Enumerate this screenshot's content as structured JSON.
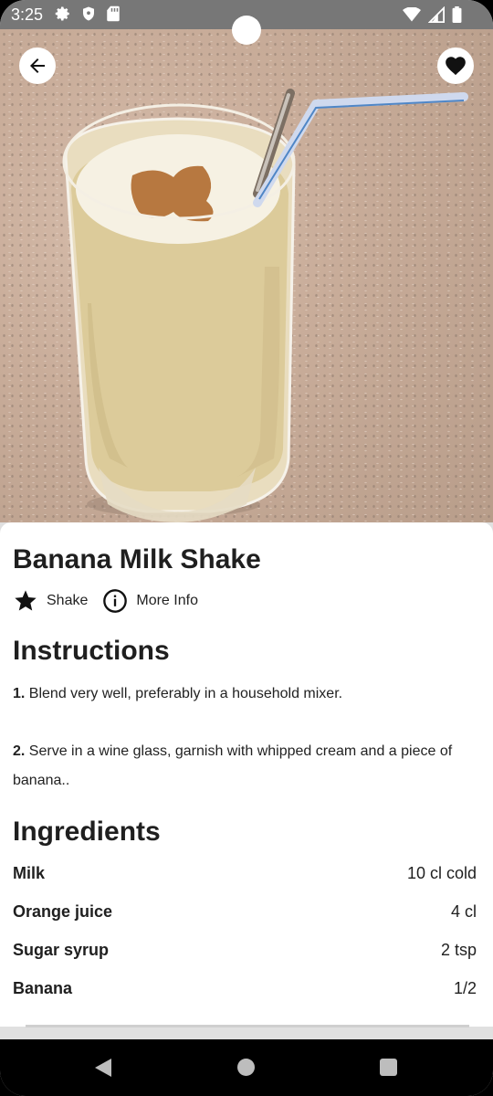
{
  "status_bar": {
    "time": "3:25",
    "left_icons": [
      "gear-icon",
      "shield-icon",
      "sd-card-icon"
    ],
    "right_icons": [
      "wifi-icon",
      "signal-icon",
      "battery-icon"
    ]
  },
  "hero": {
    "image": "banana-milk-shake-photo",
    "back_icon": "arrow-left-icon",
    "favorite_icon": "heart-icon"
  },
  "drink": {
    "name": "Banana Milk Shake",
    "category": "Shake",
    "more_info": "More Info"
  },
  "instructions": {
    "heading": "Instructions",
    "steps": [
      {
        "number": "1.",
        "text": "Blend very well, preferably in a household mixer."
      },
      {
        "number": "2.",
        "text": "Serve in a wine glass, garnish with whipped cream and a piece of banana.."
      }
    ]
  },
  "ingredients": {
    "heading": "Ingredients",
    "items": [
      {
        "name": "Milk",
        "measure": "10 cl cold"
      },
      {
        "name": "Orange juice",
        "measure": "4 cl"
      },
      {
        "name": "Sugar syrup",
        "measure": "2 tsp"
      },
      {
        "name": "Banana",
        "measure": "1/2"
      }
    ]
  },
  "colors": {
    "text": "#1f1f1f",
    "status_bar": "#777777",
    "nav_bar": "#000000"
  }
}
